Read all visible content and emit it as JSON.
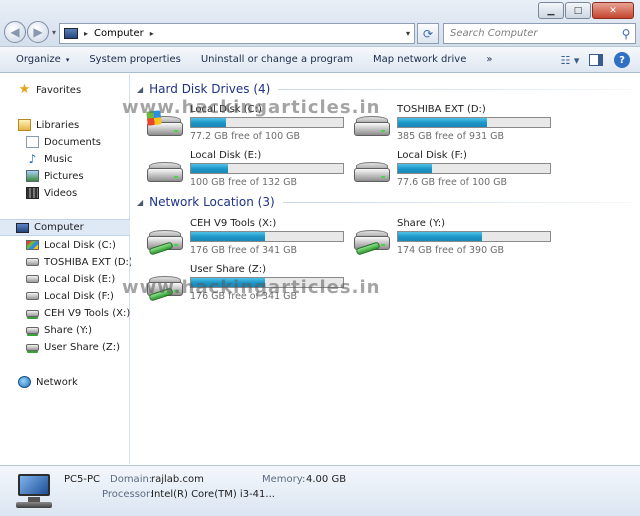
{
  "window": {
    "minimize_glyph": "▁",
    "maximize_glyph": "□",
    "close_glyph": "✕"
  },
  "address": {
    "crumb": "Computer",
    "arrow_glyph": "▸",
    "dropdown_glyph": "▾"
  },
  "search": {
    "placeholder": "Search Computer"
  },
  "toolbar": {
    "organize": "Organize",
    "system_properties": "System properties",
    "uninstall": "Uninstall or change a program",
    "map_drive": "Map network drive",
    "more": "»",
    "caret": "▾"
  },
  "sidebar": {
    "favorites": "Favorites",
    "libraries": "Libraries",
    "documents": "Documents",
    "music": "Music",
    "pictures": "Pictures",
    "videos": "Videos",
    "computer": "Computer",
    "drives": [
      "Local Disk (C:)",
      "TOSHIBA EXT (D:)",
      "Local Disk (E:)",
      "Local Disk (F:)",
      "CEH V9 Tools (X:)",
      "Share (Y:)",
      "User Share (Z:)"
    ],
    "network": "Network"
  },
  "groups": {
    "hard_disk": "Hard Disk Drives (4)",
    "network": "Network Location (3)",
    "arrow": "◢"
  },
  "drives": [
    {
      "name": "Local Disk (C:)",
      "free": "77.2 GB free of 100 GB",
      "used_fraction": 0.228
    },
    {
      "name": "TOSHIBA EXT (D:)",
      "free": "385 GB free of 931 GB",
      "used_fraction": 0.586
    },
    {
      "name": "Local Disk (E:)",
      "free": "100 GB free of 132 GB",
      "used_fraction": 0.242
    },
    {
      "name": "Local Disk (F:)",
      "free": "77.6 GB free of 100 GB",
      "used_fraction": 0.224
    }
  ],
  "network_drives": [
    {
      "name": "CEH V9 Tools (X:)",
      "free": "176 GB free of 341 GB",
      "used_fraction": 0.484
    },
    {
      "name": "Share (Y:)",
      "free": "174 GB free of 390 GB",
      "used_fraction": 0.554
    },
    {
      "name": "User Share (Z:)",
      "free": "176 GB free of 341 GB",
      "used_fraction": 0.484
    }
  ],
  "watermark": "www.hackingarticles.in",
  "details": {
    "pc_name": "PC5-PC",
    "domain_label": "Domain:",
    "domain_value": "rajlab.com",
    "memory_label": "Memory:",
    "memory_value": "4.00 GB",
    "processor_label": "Processor:",
    "processor_value": "Intel(R) Core(TM) i3-41..."
  },
  "colors": {
    "bar_fill": "#1b94c6",
    "group_title": "#1e3287",
    "selected_bg": "#dfe9f6"
  }
}
